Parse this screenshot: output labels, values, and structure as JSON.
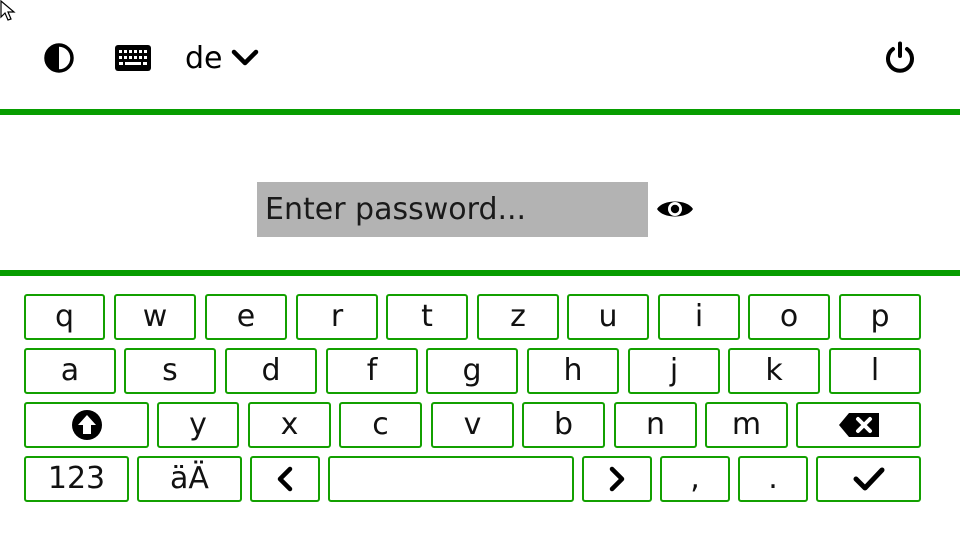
{
  "topbar": {
    "layout_label": "de"
  },
  "password": {
    "placeholder": "Enter password..."
  },
  "keyboard": {
    "row1": [
      "q",
      "w",
      "e",
      "r",
      "t",
      "z",
      "u",
      "i",
      "o",
      "p"
    ],
    "row2": [
      "a",
      "s",
      "d",
      "f",
      "g",
      "h",
      "j",
      "k",
      "l"
    ],
    "row3": [
      "y",
      "x",
      "c",
      "v",
      "b",
      "n",
      "m"
    ],
    "numbers_key": "123",
    "umlaut_key": "äÄ",
    "comma_key": ",",
    "period_key": "."
  },
  "colors": {
    "accent_green": "#079d00",
    "field_gray": "#b3b3b3"
  },
  "icons": [
    "cursor-icon",
    "contrast-icon",
    "keyboard-icon",
    "chevron-down-icon",
    "power-icon",
    "eye-icon",
    "shift-icon",
    "backspace-icon",
    "arrow-left-icon",
    "arrow-right-icon",
    "checkmark-icon"
  ]
}
